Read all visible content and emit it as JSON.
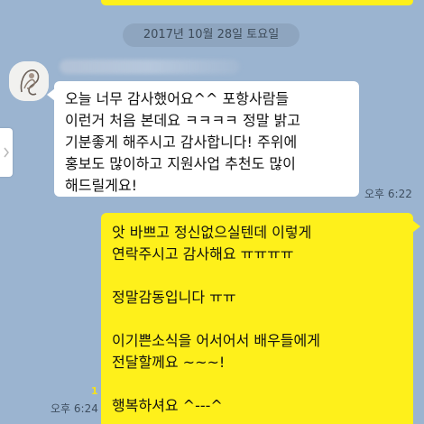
{
  "previous": {
    "time": "오후 6:22"
  },
  "date_divider": "2017년 10월 28일 토요일",
  "incoming": {
    "text": "오늘 너무 감사했어요^^ 포항사람들\n이런거 처음 본데요 ㅋㅋㅋㅋ 정말 밝고\n기분좋게 해주시고 감사합니다! 주위에\n홍보도 많이하고 지원사업 추천도 많이\n해드릴게요!",
    "time": "오후 6:22"
  },
  "outgoing": {
    "text": "앗 바쁘고 정신없으실텐데 이렇게\n연락주시고 감사해요 ㅠㅠㅠㅠ\n\n정말감동입니다 ㅠㅠ\n\n이기쁜소식을 어서어서 배우들에게\n전달할께요 ~~~!\n\n행복하셔요 ^---^",
    "unread_count": "1",
    "time": "오후 6:24"
  },
  "colors": {
    "background": "#9bb4d0",
    "my_bubble": "#fef01b",
    "their_bubble": "#ffffff"
  }
}
